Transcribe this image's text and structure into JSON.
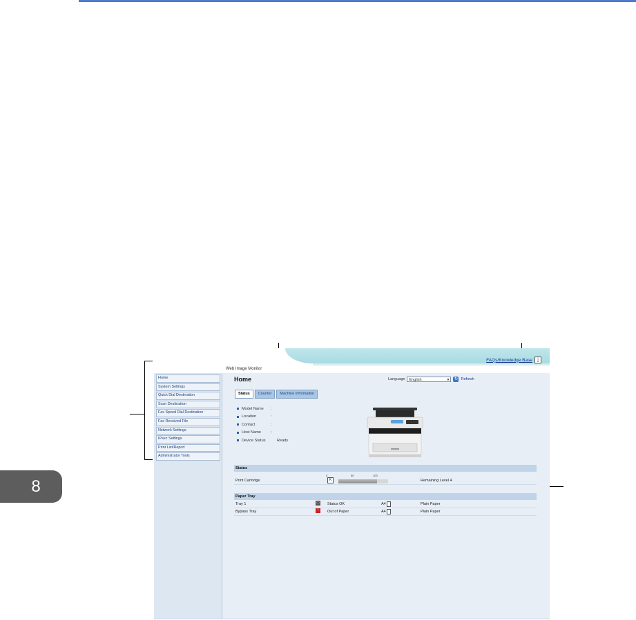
{
  "chapter": {
    "number": "8"
  },
  "app": {
    "title": "Web Image Monitor"
  },
  "header": {
    "faq_link": "FAQs/Knowledge Base",
    "info_icon": "info-icon"
  },
  "sidebar": {
    "items": [
      {
        "label": "Home"
      },
      {
        "label": "System Settings"
      },
      {
        "label": "Quick Dial Destination"
      },
      {
        "label": "Scan Destination"
      },
      {
        "label": "Fax Speed Dial Destination"
      },
      {
        "label": "Fax Received File"
      },
      {
        "label": "Network Settings"
      },
      {
        "label": "IPsec Settings"
      },
      {
        "label": "Print List/Report"
      },
      {
        "label": "Administrator Tools"
      }
    ]
  },
  "main": {
    "title": "Home",
    "language_label": "Language",
    "language_value": "English",
    "refresh_label": "Refresh",
    "tabs": [
      {
        "label": "Status",
        "active": true
      },
      {
        "label": "Counter",
        "active": false
      },
      {
        "label": "Machine Information",
        "active": false
      }
    ],
    "info": [
      {
        "label": "Model Name",
        "value": ""
      },
      {
        "label": "Location",
        "value": ""
      },
      {
        "label": "Contact",
        "value": ""
      },
      {
        "label": "Host Name",
        "value": ""
      },
      {
        "label": "Device Status",
        "value": "Ready"
      }
    ],
    "status_section": {
      "heading": "Status",
      "scale": [
        "0",
        "50",
        "100"
      ],
      "cartridge_label": "Print Cartridge",
      "cartridge_level_fraction": 0.78,
      "cartridge_text": "Remaining Level 4"
    },
    "paper_section": {
      "heading": "Paper Tray",
      "rows": [
        {
          "tray": "Tray 1",
          "status": "Status OK",
          "size": "A4",
          "type": "Plain Paper",
          "status_color": "#555555"
        },
        {
          "tray": "Bypass Tray",
          "status": "Out of Paper",
          "size": "A4",
          "type": "Plain Paper",
          "status_color": "#cc2222"
        }
      ]
    }
  },
  "colors": {
    "accent": "#4c7bd0",
    "sidebar_bg": "#dce7f2",
    "main_bg": "#e7eef6",
    "header_teal": "#a8dbe2"
  }
}
